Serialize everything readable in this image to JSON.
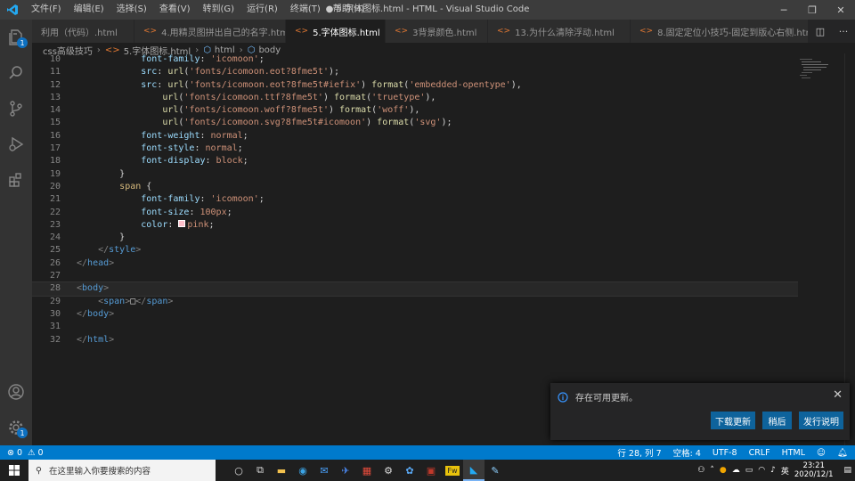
{
  "menu": [
    "文件(F)",
    "编辑(E)",
    "选择(S)",
    "查看(V)",
    "转到(G)",
    "运行(R)",
    "终端(T)",
    "帮助(H)"
  ],
  "window_title": "● 5.字体图标.html - HTML - Visual Studio Code",
  "tabs": [
    {
      "label": "利用（代码）.html",
      "active": false,
      "dirty": false
    },
    {
      "label": "4.用精灵图拼出自己的名字.html",
      "active": false,
      "dirty": false
    },
    {
      "label": "5.字体图标.html",
      "active": true,
      "dirty": true
    },
    {
      "label": "3背景颜色.html",
      "active": false,
      "dirty": false
    },
    {
      "label": "13.为什么清除浮动.html",
      "active": false,
      "dirty": false
    },
    {
      "label": "8.固定定位小技巧-固定到版心右侧.html",
      "active": false,
      "dirty": false
    }
  ],
  "breadcrumb": [
    "css高级技巧",
    "5.字体图标.html",
    "html",
    "body"
  ],
  "code_lines": [
    {
      "n": "10",
      "text": "            font-family: 'icomoon';"
    },
    {
      "n": "11",
      "text": "            src: url('fonts/icomoon.eot?8fme5t');"
    },
    {
      "n": "12",
      "text": "            src: url('fonts/icomoon.eot?8fme5t#iefix') format('embedded-opentype'),"
    },
    {
      "n": "13",
      "text": "                url('fonts/icomoon.ttf?8fme5t') format('truetype'),"
    },
    {
      "n": "14",
      "text": "                url('fonts/icomoon.woff?8fme5t') format('woff'),"
    },
    {
      "n": "15",
      "text": "                url('fonts/icomoon.svg?8fme5t#icomoon') format('svg');"
    },
    {
      "n": "16",
      "text": "            font-weight: normal;"
    },
    {
      "n": "17",
      "text": "            font-style: normal;"
    },
    {
      "n": "18",
      "text": "            font-display: block;"
    },
    {
      "n": "19",
      "text": "        }"
    },
    {
      "n": "20",
      "text": "        span {"
    },
    {
      "n": "21",
      "text": "            font-family: 'icomoon';"
    },
    {
      "n": "22",
      "text": "            font-size: 100px;"
    },
    {
      "n": "23",
      "text": "            color: ■pink;"
    },
    {
      "n": "24",
      "text": "        }"
    },
    {
      "n": "25",
      "text": "    </style>"
    },
    {
      "n": "26",
      "text": "</head>"
    },
    {
      "n": "27",
      "text": ""
    },
    {
      "n": "28",
      "text": "<body>"
    },
    {
      "n": "29",
      "text": "    <span>□</span>"
    },
    {
      "n": "30",
      "text": "</body>"
    },
    {
      "n": "31",
      "text": ""
    },
    {
      "n": "32",
      "text": "</html>"
    }
  ],
  "notification": {
    "message": "存在可用更新。",
    "buttons": [
      "下载更新",
      "稍后",
      "发行说明"
    ]
  },
  "status": {
    "errors": "0",
    "warnings": "0",
    "position": "行 28, 列 7",
    "spaces": "空格: 4",
    "encoding": "UTF-8",
    "eol": "CRLF",
    "language": "HTML"
  },
  "taskbar": {
    "search_placeholder": "在这里输入你要搜索的内容",
    "ime": "英",
    "time": "23:21",
    "date": "2020/12/1"
  },
  "colors": {
    "accent": "#007acc",
    "pink": "#ffc0cb"
  }
}
